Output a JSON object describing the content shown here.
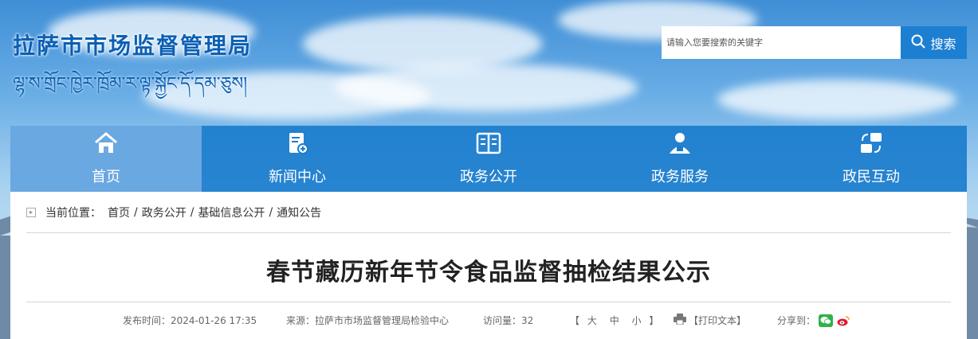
{
  "header": {
    "site_title": "拉萨市市场监督管理局",
    "site_subtitle_tibetan": "ལྷ་ས་གྲོང་ཁྱེར་ཁྲོམ་ར་ལྟ་སྐྱོང་དོ་དམ་ཅུས།"
  },
  "search": {
    "placeholder": "请输入您要搜索的关键字",
    "button_label": "搜索"
  },
  "nav": {
    "items": [
      {
        "label": "首页",
        "icon": "home-icon",
        "active": true
      },
      {
        "label": "新闻中心",
        "icon": "news-icon"
      },
      {
        "label": "政务公开",
        "icon": "book-icon"
      },
      {
        "label": "政务服务",
        "icon": "person-icon"
      },
      {
        "label": "政民互动",
        "icon": "exchange-icon"
      }
    ]
  },
  "breadcrumb": {
    "prefix": "当前位置：",
    "items": [
      "首页",
      "政务公开",
      "基础信息公开",
      "通知公告"
    ],
    "separator": "/"
  },
  "article": {
    "title": "春节藏历新年节令食品监督抽检结果公示",
    "publish_time": "发布时间：2024-01-26 17:35",
    "source": "来源：拉萨市市场监督管理局检验中心",
    "views": "访问量：32",
    "font_size_open": "【",
    "font_size_large": "大",
    "font_size_medium": "中",
    "font_size_small": "小",
    "font_size_close": "】",
    "print_label": "【打印文本】",
    "share_label": "分享到："
  },
  "colors": {
    "nav_bg": "#1b7dcd",
    "nav_active": "#6eaae1",
    "title_blue": "#0a5fb4",
    "search_button": "#1d7fd1"
  }
}
